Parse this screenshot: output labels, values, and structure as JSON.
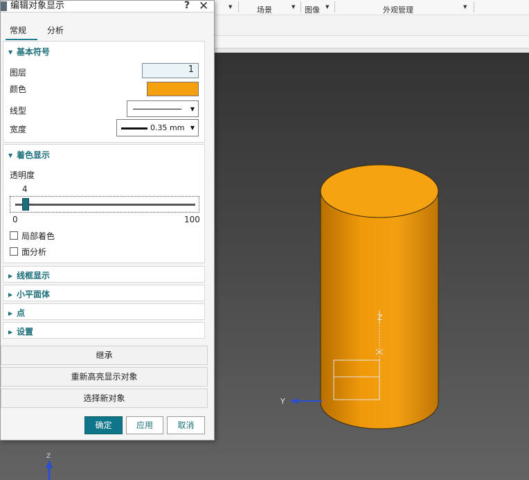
{
  "app": {
    "toolbar": [
      {
        "label": "场景"
      },
      {
        "label": "图像"
      },
      {
        "label": "外观管理"
      }
    ]
  },
  "scene": {
    "cylinder_color": "#f5a00f",
    "axis_z_label": "Z",
    "axis_y_label": "Y",
    "bottom_axis_label": "Z"
  },
  "dialog": {
    "title": "编辑对象显示",
    "help_glyph": "?",
    "close_glyph": "✕",
    "tabs": [
      {
        "label": "常规",
        "active": true
      },
      {
        "label": "分析",
        "active": false
      }
    ],
    "basic_symbols": {
      "header": "基本符号",
      "layer_label": "图层",
      "layer_value": "1",
      "color_label": "颜色",
      "color_value": "#f5a00f",
      "linetype_label": "线型",
      "width_label": "宽度",
      "width_value": "0.35 mm"
    },
    "shading": {
      "header": "着色显示",
      "transparency_label": "透明度",
      "transparency_value": "4",
      "slider_min": "0",
      "slider_max": "100",
      "slider_fraction": 0.04,
      "local_shading_label": "局部着色",
      "face_analysis_label": "面分析"
    },
    "collapsed_sections": [
      "线框显示",
      "小平面体",
      "点",
      "设置"
    ],
    "buttons": {
      "inherit": "继承",
      "rehighlight": "重新高亮显示对象",
      "select_new": "选择新对象",
      "ok": "确定",
      "apply": "应用",
      "cancel": "取消"
    }
  }
}
